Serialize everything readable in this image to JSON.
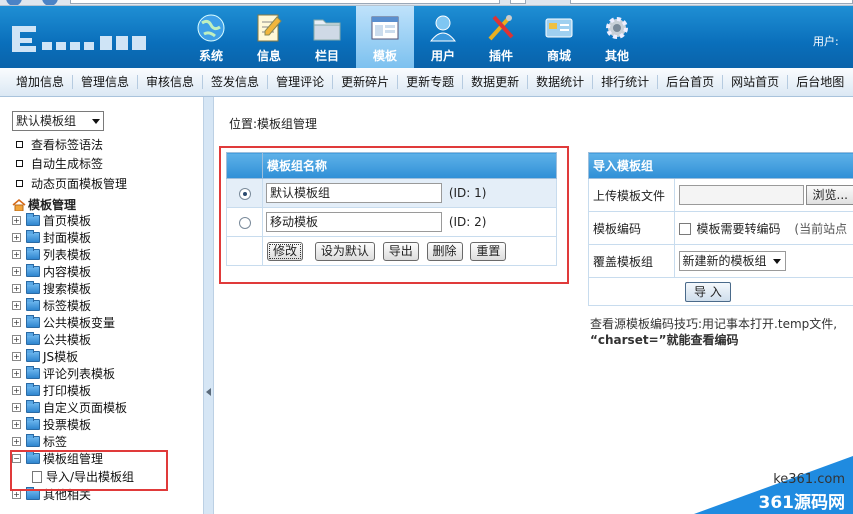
{
  "header": {
    "nav": [
      {
        "label": "系统",
        "icon": "globe-icon"
      },
      {
        "label": "信息",
        "icon": "notepad-icon"
      },
      {
        "label": "栏目",
        "icon": "folder-icon"
      },
      {
        "label": "模板",
        "icon": "window-icon",
        "active": true
      },
      {
        "label": "用户",
        "icon": "user-icon"
      },
      {
        "label": "插件",
        "icon": "tools-icon"
      },
      {
        "label": "商城",
        "icon": "card-icon"
      },
      {
        "label": "其他",
        "icon": "gear-icon"
      }
    ],
    "user_label": "用户:"
  },
  "subnav": [
    "增加信息",
    "管理信息",
    "审核信息",
    "签发信息",
    "管理评论",
    "更新碎片",
    "更新专题",
    "数据更新",
    "数据统计",
    "排行统计",
    "后台首页",
    "网站首页",
    "后台地图"
  ],
  "sidebar": {
    "group_select": "默认模板组",
    "links": [
      "查看标签语法",
      "自动生成标签",
      "动态页面模板管理"
    ],
    "root": "模板管理",
    "nodes": [
      "首页模板",
      "封面模板",
      "列表模板",
      "内容模板",
      "搜索模板",
      "标签模板",
      "公共模板变量",
      "公共模板",
      "JS模板",
      "评论列表模板",
      "打印模板",
      "自定义页面模板",
      "投票模板",
      "标签"
    ],
    "group_mgmt": {
      "label": "模板组管理",
      "expanded": true,
      "child": "导入/导出模板组"
    },
    "last_node": "其他相关"
  },
  "main": {
    "breadcrumb_prefix": "位置:",
    "breadcrumb": "模板组管理",
    "group_table": {
      "header": "模板组名称",
      "rows": [
        {
          "name": "默认模板组",
          "id": "(ID: 1)",
          "selected": true
        },
        {
          "name": "移动模板",
          "id": "(ID: 2)",
          "selected": false
        }
      ],
      "buttons": [
        "修改",
        "设为默认",
        "导出",
        "删除",
        "重置"
      ]
    },
    "import_table": {
      "header": "导入模板组",
      "upload_label": "上传模板文件",
      "browse_label": "浏览...",
      "encoding_label": "模板编码",
      "encoding_checkbox": "模板需要转编码",
      "encoding_note": "(当前站点",
      "override_label": "覆盖模板组",
      "override_value": "新建新的模板组",
      "import_button": "导 入"
    },
    "tip_line1": "查看源模板编码技巧:用记事本打开.temp文件,",
    "tip_line2": "“charset=”就能查看编码"
  },
  "watermark": {
    "site": "ke361.com",
    "brand": "361源码网"
  },
  "colors": {
    "header": "#0a6fbb",
    "accent": "#2f8fd6",
    "highlight_box": "#e03a3a"
  }
}
